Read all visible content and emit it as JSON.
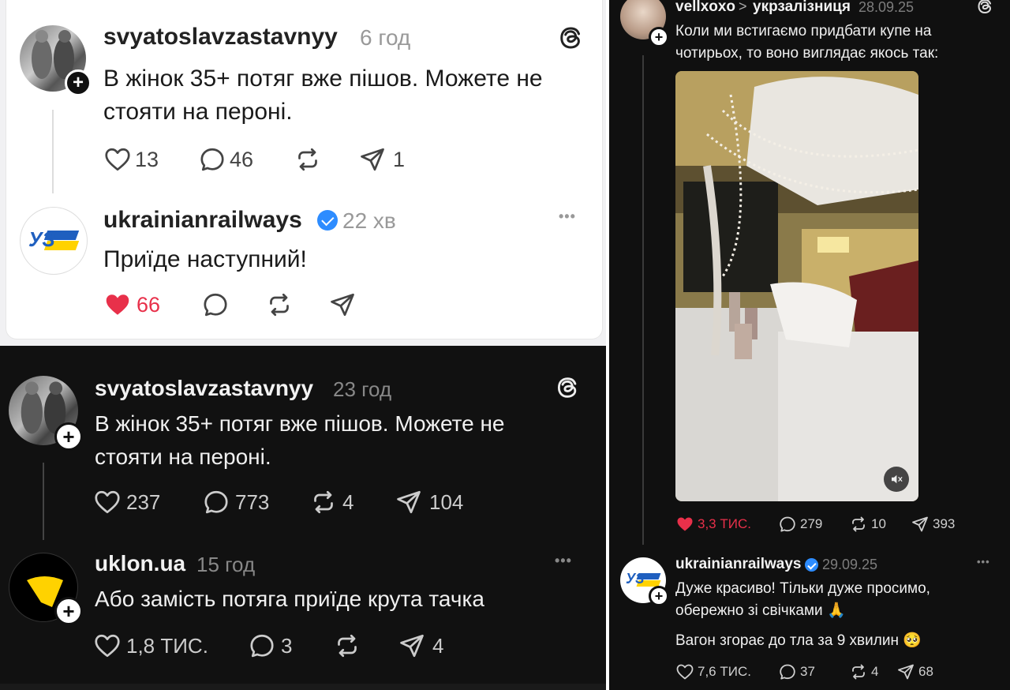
{
  "colors": {
    "like_red": "#e8304a",
    "verified_blue": "#2d8cff",
    "dark_bg": "#111111",
    "light_bg": "#ffffff"
  },
  "panel1": {
    "post": {
      "username": "svyatoslavzastavnyy",
      "time": "6 год",
      "text": "В жінок 35+ потяг вже пішов. Можете не стояти на пероні.",
      "likes": "13",
      "comments": "46",
      "reposts": "",
      "shares": "1"
    },
    "reply": {
      "username": "ukrainianrailways",
      "time": "22 хв",
      "text": "Приїде наступний!",
      "avatar_text": "УЗ",
      "likes": "66",
      "comments": "",
      "reposts": "",
      "shares": "",
      "more": "•••"
    }
  },
  "panel2": {
    "post": {
      "username": "svyatoslavzastavnyy",
      "time": "23 год",
      "text": "В жінок 35+ потяг вже пішов. Можете не стояти на пероні.",
      "likes": "237",
      "comments": "773",
      "reposts": "4",
      "shares": "104"
    },
    "reply": {
      "username": "uklon.ua",
      "time": "15 год",
      "text": "Або замість потяга приїде крута тачка",
      "likes": "1,8 ТИС.",
      "comments": "3",
      "reposts": "",
      "shares": "4",
      "more": "•••"
    }
  },
  "panel3": {
    "post": {
      "username": "vellxoxo",
      "separator": ">",
      "topic": "укрзалізниця",
      "time": "28.09.25",
      "text": "Коли ми встигаємо придбати купе на чотирьох, то воно виглядає якось так:",
      "likes": "3,3 ТИС.",
      "comments": "279",
      "reposts": "10",
      "shares": "393"
    },
    "reply": {
      "username": "ukrainianrailways",
      "time": "29.09.25",
      "avatar_text": "УЗ",
      "text1": "Дуже красиво! Тільки дуже просимо, обережно зі свічками 🙏",
      "text2": "Вагон згорає до тла за 9 хвилин 🥺",
      "likes": "7,6 ТИС.",
      "comments": "37",
      "reposts": "4",
      "shares": "68",
      "more": "•••"
    }
  }
}
